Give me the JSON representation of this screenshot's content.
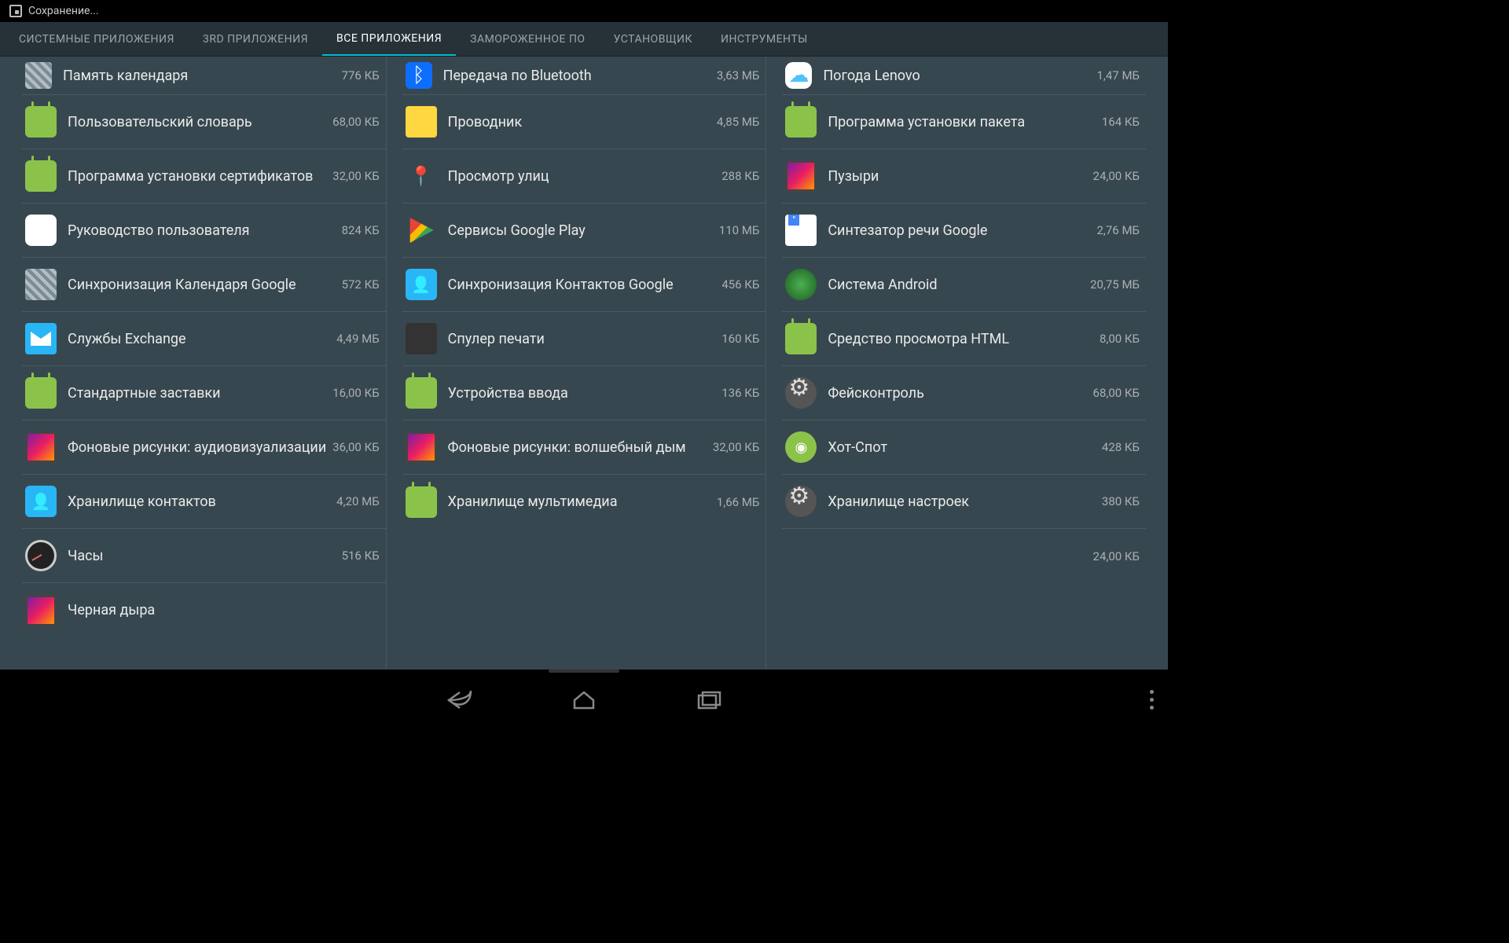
{
  "status": {
    "text": "Сохранение..."
  },
  "tabs": [
    {
      "label": "СИСТЕМНЫЕ ПРИЛОЖЕНИЯ"
    },
    {
      "label": "3RD ПРИЛОЖЕНИЯ"
    },
    {
      "label": "ВСЕ ПРИЛОЖЕНИЯ"
    },
    {
      "label": "ЗАМОРОЖЕННОЕ ПО"
    },
    {
      "label": "УСТАНОВЩИК"
    },
    {
      "label": "ИНСТРУМЕНТЫ"
    }
  ],
  "active_tab": 2,
  "columns": [
    [
      {
        "name": "Память календаря",
        "size": "776 КБ",
        "icon": "grid",
        "first": true
      },
      {
        "name": "Пользовательский словарь",
        "size": "68,00 КБ",
        "icon": "android"
      },
      {
        "name": "Программа установки сертификатов",
        "size": "32,00 КБ",
        "icon": "android"
      },
      {
        "name": "Руководство пользователя",
        "size": "824 КБ",
        "icon": "white"
      },
      {
        "name": "Синхронизация Календаря Google",
        "size": "572 КБ",
        "icon": "grid"
      },
      {
        "name": "Службы Exchange",
        "size": "4,49 МБ",
        "icon": "env"
      },
      {
        "name": "Стандартные заставки",
        "size": "16,00 КБ",
        "icon": "android"
      },
      {
        "name": "Фоновые рисунки: аудиовизуализации",
        "size": "36,00 КБ",
        "icon": "wall"
      },
      {
        "name": "Хранилище контактов",
        "size": "4,20 МБ",
        "icon": "contact"
      },
      {
        "name": "Часы",
        "size": "516 КБ",
        "icon": "clock"
      },
      {
        "name": "Черная дыра",
        "size": "",
        "icon": "wall"
      }
    ],
    [
      {
        "name": "Передача по Bluetooth",
        "size": "3,63 МБ",
        "icon": "bt",
        "first": true
      },
      {
        "name": "Проводник",
        "size": "4,85 МБ",
        "icon": "folder"
      },
      {
        "name": "Просмотр улиц",
        "size": "288 КБ",
        "icon": "pin"
      },
      {
        "name": "Сервисы Google Play",
        "size": "110 МБ",
        "icon": "play"
      },
      {
        "name": "Синхронизация Контактов Google",
        "size": "456 КБ",
        "icon": "contact"
      },
      {
        "name": "Спулер печати",
        "size": "160 КБ",
        "icon": "dark"
      },
      {
        "name": "Устройства ввода",
        "size": "136 КБ",
        "icon": "android"
      },
      {
        "name": "Фоновые рисунки: волшебный дым",
        "size": "32,00 КБ",
        "icon": "wall"
      },
      {
        "name": "Хранилище мультимедиа",
        "size": "1,66 МБ",
        "icon": "android"
      }
    ],
    [
      {
        "name": "Погода Lenovo",
        "size": "1,47 МБ",
        "icon": "cloud",
        "first": true
      },
      {
        "name": "Программа установки пакета",
        "size": "164 КБ",
        "icon": "android"
      },
      {
        "name": "Пузыри",
        "size": "24,00 КБ",
        "icon": "wall"
      },
      {
        "name": "Синтезатор речи Google",
        "size": "2,76 МБ",
        "icon": "doc"
      },
      {
        "name": "Система Android",
        "size": "20,75 МБ",
        "icon": "globe"
      },
      {
        "name": "Средство просмотра HTML",
        "size": "8,00 КБ",
        "icon": "android"
      },
      {
        "name": "Фейсконтроль",
        "size": "68,00 КБ",
        "icon": "gear"
      },
      {
        "name": "Хот-Спот",
        "size": "428 КБ",
        "icon": "hotspot"
      },
      {
        "name": "Хранилище настроек",
        "size": "380 КБ",
        "icon": "gear"
      },
      {
        "name": "",
        "size": "24,00 КБ",
        "icon": "none",
        "nameonly": true
      }
    ]
  ]
}
